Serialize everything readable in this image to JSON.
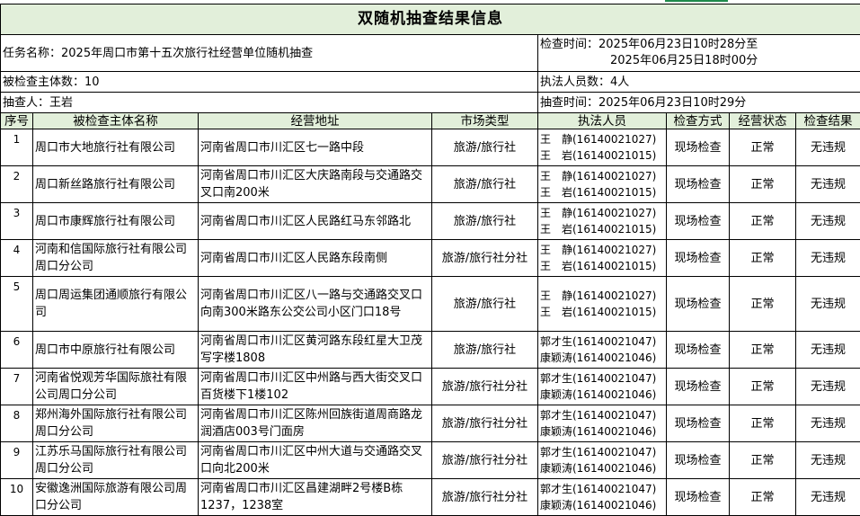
{
  "title": "双随机抽查结果信息",
  "task": "任务名称：2025年周口市第十五次旅行社经营单位随机抽查",
  "check_time_line1": "检查时间：2025年06月23日10时28分至",
  "check_time_line2": "2025年06月25日18时00分",
  "subject_count": "被检查主体数：10",
  "officer_count": "执法人员数：4人",
  "sampler": "抽查人：王岩",
  "sample_time": "抽查时间：2025年06月23日10时29分",
  "headers": [
    "序号",
    "被检查主体名称",
    "经营地址",
    "市场类型",
    "执法人员",
    "检查方式",
    "经营状态",
    "检查结果"
  ],
  "rows": [
    {
      "no": "1",
      "name": "周口市大地旅行社有限公司",
      "addr": "河南省周口市川汇区七一路中段",
      "type": "旅游/旅行社",
      "o1": "王　静(16140021027)",
      "o2": "王　岩(16140021015)",
      "method": "现场检查",
      "status": "正常",
      "result": "无违规"
    },
    {
      "no": "2",
      "name": "周口新丝路旅行社有限公司",
      "addr": "河南省周口市川汇区大庆路南段与交通路交叉口南200米",
      "type": "旅游/旅行社",
      "o1": "王　静(16140021027)",
      "o2": "王　岩(16140021015)",
      "method": "现场检查",
      "status": "正常",
      "result": "无违规"
    },
    {
      "no": "3",
      "name": "周口市康辉旅行社有限公司",
      "addr": "河南省周口市川汇区人民路红马东邻路北",
      "type": "旅游/旅行社",
      "o1": "王　静(16140021027)",
      "o2": "王　岩(16140021015)",
      "method": "现场检查",
      "status": "正常",
      "result": "无违规"
    },
    {
      "no": "4",
      "name": "河南和信国际旅行社有限公司周口分公司",
      "addr": "河南省周口市川汇区人民路东段南侧",
      "type": "旅游/旅行社分社",
      "o1": "王　静(16140021027)",
      "o2": "王　岩(16140021015)",
      "method": "现场检查",
      "status": "正常",
      "result": "无违规"
    },
    {
      "no": "5",
      "name": "周口周运集团通顺旅行有限公司",
      "addr": "河南省周口市川汇区八一路与交通路交叉口向南300米路东公交公司小区门口18号",
      "type": "旅游/旅行社",
      "o1": "王　静(16140021027)",
      "o2": "王　岩(16140021015)",
      "method": "现场检查",
      "status": "正常",
      "result": "无违规"
    },
    {
      "no": "6",
      "name": "周口市中原旅行社有限公司",
      "addr": "河南省周口市川汇区黄河路东段红星大卫茂写字楼1808",
      "type": "旅游/旅行社",
      "o1": "郭才生(16140021047)",
      "o2": "康颖涛(16140021046)",
      "method": "现场检查",
      "status": "正常",
      "result": "无违规"
    },
    {
      "no": "7",
      "name": "河南省悦观芳华国际旅社有限公司周口分公司",
      "addr": "河南省周口市川汇区中州路与西大街交叉口百货楼下1楼102",
      "type": "旅游/旅行社分社",
      "o1": "郭才生(16140021047)",
      "o2": "康颖涛(16140021046)",
      "method": "现场检查",
      "status": "正常",
      "result": "无违规"
    },
    {
      "no": "8",
      "name": "郑州海外国际旅行社有限公司周口分公司",
      "addr": "河南省周口市川汇区陈州回族街道周商路龙润酒店003号门面房",
      "type": "旅游/旅行社分社",
      "o1": "郭才生(16140021047)",
      "o2": "康颖涛(16140021046)",
      "method": "现场检查",
      "status": "正常",
      "result": "无违规"
    },
    {
      "no": "9",
      "name": "江苏乐马国际旅行社有限公司周口分公司",
      "addr": "河南省周口市川汇区中州大道与交通路交叉口向北200米",
      "type": "旅游/旅行社分社",
      "o1": "郭才生(16140021047)",
      "o2": "康颖涛(16140021046)",
      "method": "现场检查",
      "status": "正常",
      "result": "无违规"
    },
    {
      "no": "10",
      "name": "安徽逸洲国际旅游有限公司周口分公司",
      "addr": "河南省周口市川汇区昌建湖畔2号楼B栋1237，1238室",
      "type": "旅游/旅行社分社",
      "o1": "郭才生(16140021047)",
      "o2": "康颖涛(16140021046)",
      "method": "现场检查",
      "status": "正常",
      "result": "无违规"
    }
  ]
}
